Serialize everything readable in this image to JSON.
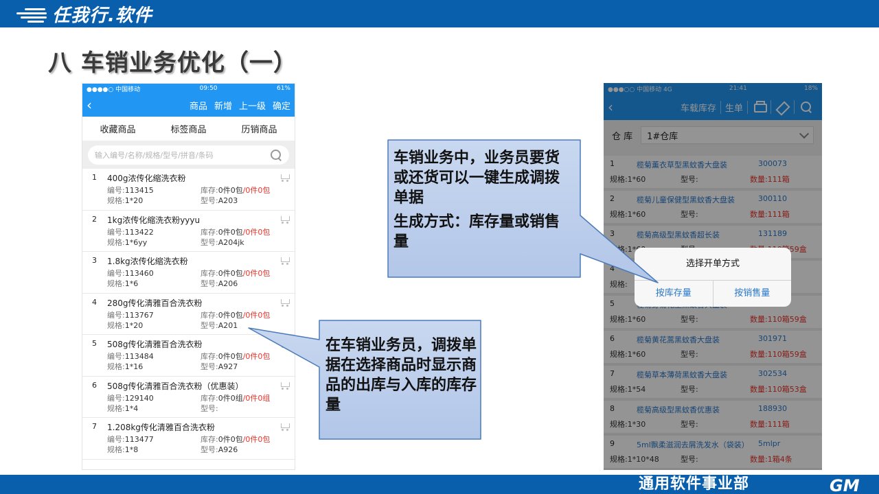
{
  "brand": {
    "name": "任我行.软件"
  },
  "department": "通用软件事业部",
  "gm_logo": "GM",
  "title": "八  车销业务优化（一）",
  "left_phone": {
    "status": {
      "carrier": "●●●●○ 中国移动",
      "time": "09:50",
      "battery": "61%"
    },
    "nav": {
      "back": "‹",
      "buttons": [
        "商品",
        "新增",
        "上一级",
        "确定"
      ]
    },
    "tabs": [
      "收藏商品",
      "标签商品",
      "历销商品"
    ],
    "search_placeholder": "输入编号/名称/规格/型号/拼音/条码",
    "labels": {
      "code": "编号:",
      "spec": "规格:",
      "stock": "库存:",
      "model": "型号:"
    },
    "products": [
      {
        "idx": "1",
        "name": "400g浓传化缩洗衣粉",
        "code": "113415",
        "spec": "1*20",
        "stock_a": "0件0包",
        "stock_b": "/0件0包",
        "model": "A203"
      },
      {
        "idx": "2",
        "name": "1kg浓传化缩洗衣粉yyyu",
        "code": "113422",
        "spec": "1*6yy",
        "stock_a": "0件0包",
        "stock_b": "/0件0包",
        "model": "A204jk"
      },
      {
        "idx": "3",
        "name": "1.8kg浓传化缩洗衣粉",
        "code": "113460",
        "spec": "1*6",
        "stock_a": "0件0包",
        "stock_b": "/0件0包",
        "model": "A206"
      },
      {
        "idx": "4",
        "name": "280g传化清雅百合洗衣粉",
        "code": "113767",
        "spec": "1*20",
        "stock_a": "0件0包",
        "stock_b": "/0件0包",
        "model": "A201"
      },
      {
        "idx": "5",
        "name": "508g传化清雅百合洗衣粉",
        "code": "113484",
        "spec": "1*16",
        "stock_a": "0件0包",
        "stock_b": "/0件0包",
        "model": "A927"
      },
      {
        "idx": "6",
        "name": "508g传化清雅百合洗衣粉（优惠装）",
        "code": "129140",
        "spec": "1*4",
        "stock_a": "0件0组",
        "stock_b": "/0件0组",
        "model": ""
      },
      {
        "idx": "7",
        "name": "1.208kg传化清雅百合洗衣粉",
        "code": "113477",
        "spec": "1*8",
        "stock_a": "0件0包",
        "stock_b": "/0件0包",
        "model": "A926"
      }
    ]
  },
  "right_phone": {
    "status": {
      "carrier": "●●●○○ 中国移动  4G",
      "time": "21:41",
      "battery": "18%"
    },
    "nav": {
      "back": "‹",
      "buttons": [
        "车载库存",
        "生单"
      ]
    },
    "warehouse_label": "仓 库",
    "warehouse_value": "1#仓库",
    "labels": {
      "spec": "规格:",
      "model": "型号:",
      "qty": "数量:"
    },
    "items": [
      {
        "idx": "1",
        "name": "榄菊薰衣草型黑蚊香大盘装",
        "code": "300073",
        "spec": "1*60",
        "qty": "111箱"
      },
      {
        "idx": "2",
        "name": "榄菊儿童保健型黑蚊香大盘装",
        "code": "300110",
        "spec": "1*60",
        "qty": "111箱"
      },
      {
        "idx": "3",
        "name": "榄菊高级型黑蚊香超长装",
        "code": "131189",
        "spec": "1*60",
        "qty": "110箱59盒"
      },
      {
        "idx": "4",
        "name": "",
        "code": "",
        "spec": "",
        "qty": ""
      },
      {
        "idx": "5",
        "name": "榄菊野菊花型黑蚊香大盘装",
        "code": "300622",
        "spec": "1*60",
        "qty": "110箱59盒"
      },
      {
        "idx": "6",
        "name": "榄菊黄花蒿黑蚊香大盘装",
        "code": "301971",
        "spec": "1*60",
        "qty": "110箱59盒"
      },
      {
        "idx": "7",
        "name": "榄菊草本薄荷黑蚊香大盘装",
        "code": "302534",
        "spec": "1*54",
        "qty": "110箱53盒"
      },
      {
        "idx": "8",
        "name": "榄菊高级型黑蚊香优惠装",
        "code": "188930",
        "spec": "1*30",
        "qty": "111箱"
      },
      {
        "idx": "9",
        "name": "5ml飘柔滋润去屑洗发水（袋装）",
        "code": "5mlpr",
        "spec": "1*10*48",
        "qty": "1箱4条"
      }
    ],
    "dialog": {
      "title": "选择开单方式",
      "btn_stock": "按库存量",
      "btn_sales": "按销售量"
    }
  },
  "callout_top": {
    "line1": "车销业务中，业务员要货或还货可以一键生成调拨单据",
    "line2": "生成方式：库存量或销售量"
  },
  "callout_bottom": {
    "text": "在车销业务员，调拨单据在选择商品时显示商品的出库与入库的库存量"
  }
}
